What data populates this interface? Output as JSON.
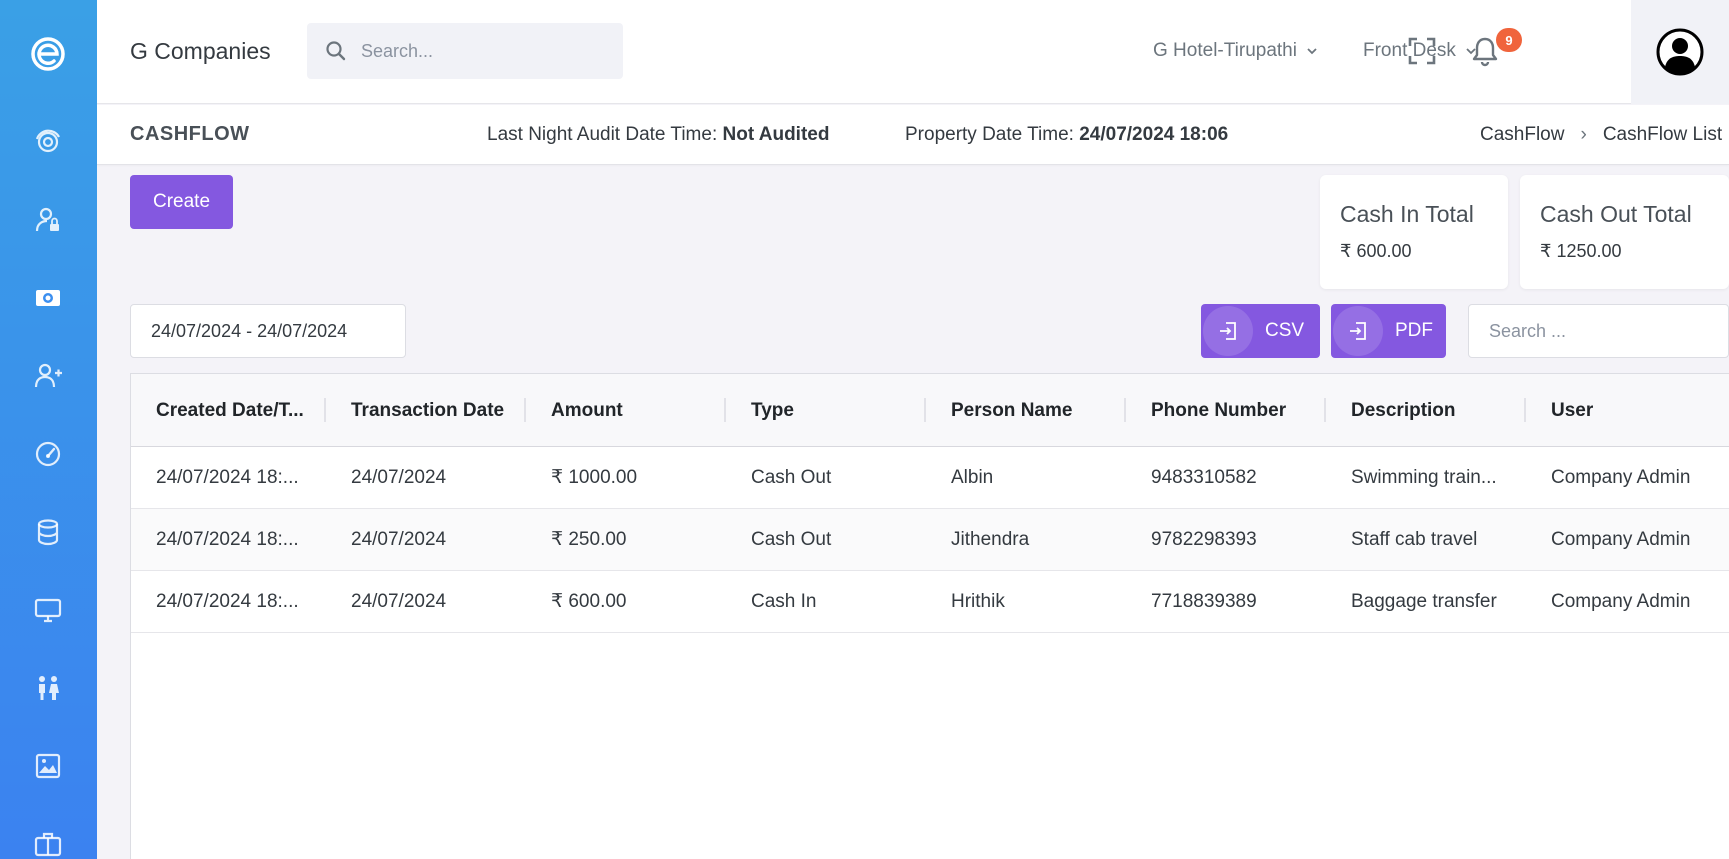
{
  "header": {
    "brand": "G Companies",
    "search_placeholder": "Search...",
    "property": "G Hotel-Tirupathi",
    "role": "Front Desk",
    "notification_count": "9"
  },
  "subheader": {
    "title": "CASHFLOW",
    "audit_label": "Last Night Audit Date Time: ",
    "audit_value": "Not Audited",
    "property_date_label": "Property Date Time: ",
    "property_date_value": "24/07/2024 18:06",
    "breadcrumb": [
      "CashFlow",
      "CashFlow List"
    ]
  },
  "actions": {
    "create_label": "Create",
    "csv_label": "CSV",
    "pdf_label": "PDF",
    "table_search_placeholder": "Search ...",
    "date_range": "24/07/2024 - 24/07/2024"
  },
  "stats": {
    "cash_in_label": "Cash In Total",
    "cash_in_value": "₹ 600.00",
    "cash_out_label": "Cash Out Total",
    "cash_out_value": "₹ 1250.00"
  },
  "table": {
    "columns": [
      "Created Date/T...",
      "Transaction Date",
      "Amount",
      "Type",
      "Person Name",
      "Phone Number",
      "Description",
      "User"
    ],
    "rows": [
      [
        "24/07/2024 18:...",
        "24/07/2024",
        "₹ 1000.00",
        "Cash Out",
        "Albin",
        "9483310582",
        "Swimming train...",
        "Company Admin"
      ],
      [
        "24/07/2024 18:...",
        "24/07/2024",
        "₹ 250.00",
        "Cash Out",
        "Jithendra",
        "9782298393",
        "Staff cab travel",
        "Company Admin"
      ],
      [
        "24/07/2024 18:...",
        "24/07/2024",
        "₹ 600.00",
        "Cash In",
        "Hrithik",
        "7718839389",
        "Baggage transfer",
        "Company Admin"
      ]
    ]
  },
  "sidebar": {
    "icons": [
      "app-logo-icon",
      "dashboard-icon",
      "user-lock-icon",
      "cashflow-icon",
      "add-user-icon",
      "speedometer-icon",
      "database-icon",
      "monitor-icon",
      "guests-icon",
      "gallery-icon",
      "briefcase-icon"
    ]
  },
  "colors": {
    "sidebar_gradient_top": "#3aa0e6",
    "sidebar_gradient_bottom": "#3b82f0",
    "accent_purple": "#8458e0",
    "badge_orange": "#f0643c"
  }
}
